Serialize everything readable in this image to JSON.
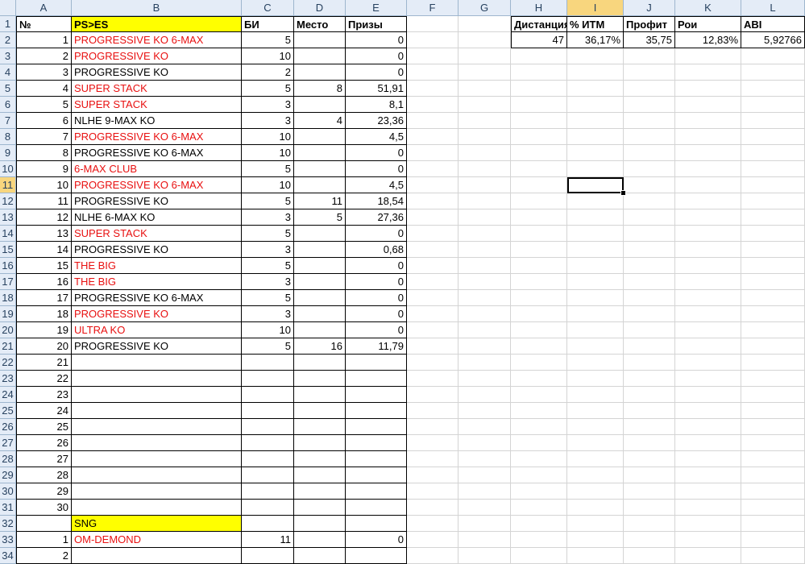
{
  "columns": [
    "A",
    "B",
    "C",
    "D",
    "E",
    "F",
    "G",
    "H",
    "I",
    "J",
    "K",
    "L"
  ],
  "selected_column": "I",
  "selected_row": 11,
  "row_numbers": [
    1,
    2,
    3,
    4,
    5,
    6,
    7,
    8,
    9,
    10,
    11,
    12,
    13,
    14,
    15,
    16,
    17,
    18,
    19,
    20,
    21,
    22,
    23,
    24,
    25,
    26,
    27,
    28,
    29,
    30,
    31,
    32,
    33,
    34
  ],
  "table_header": {
    "num": "№",
    "name": "PS>ES",
    "bi": "БИ",
    "place": "Место",
    "prize": "Призы"
  },
  "rows": [
    {
      "n": "1",
      "name": "PROGRESSIVE KO 6-MAX",
      "red": true,
      "bi": "5",
      "place": "",
      "prize": "0"
    },
    {
      "n": "2",
      "name": "PROGRESSIVE KO",
      "red": true,
      "bi": "10",
      "place": "",
      "prize": "0"
    },
    {
      "n": "3",
      "name": "PROGRESSIVE KO",
      "red": false,
      "bi": "2",
      "place": "",
      "prize": "0"
    },
    {
      "n": "4",
      "name": "SUPER STACK",
      "red": true,
      "bi": "5",
      "place": "8",
      "prize": "51,91"
    },
    {
      "n": "5",
      "name": "SUPER STACK",
      "red": true,
      "bi": "3",
      "place": "",
      "prize": "8,1"
    },
    {
      "n": "6",
      "name": "NLHE 9-MAX KO",
      "red": false,
      "bi": "3",
      "place": "4",
      "prize": "23,36"
    },
    {
      "n": "7",
      "name": "PROGRESSIVE KO 6-MAX",
      "red": true,
      "bi": "10",
      "place": "",
      "prize": "4,5"
    },
    {
      "n": "8",
      "name": "PROGRESSIVE KO 6-MAX",
      "red": false,
      "bi": "10",
      "place": "",
      "prize": "0"
    },
    {
      "n": "9",
      "name": "6-MAX CLUB",
      "red": true,
      "bi": "5",
      "place": "",
      "prize": "0"
    },
    {
      "n": "10",
      "name": "PROGRESSIVE KO 6-MAX",
      "red": true,
      "bi": "10",
      "place": "",
      "prize": "4,5"
    },
    {
      "n": "11",
      "name": "PROGRESSIVE KO",
      "red": false,
      "bi": "5",
      "place": "11",
      "prize": "18,54"
    },
    {
      "n": "12",
      "name": "NLHE 6-MAX KO",
      "red": false,
      "bi": "3",
      "place": "5",
      "prize": "27,36"
    },
    {
      "n": "13",
      "name": "SUPER STACK",
      "red": true,
      "bi": "5",
      "place": "",
      "prize": "0"
    },
    {
      "n": "14",
      "name": "PROGRESSIVE KO",
      "red": false,
      "bi": "3",
      "place": "",
      "prize": "0,68"
    },
    {
      "n": "15",
      "name": "THE BIG",
      "red": true,
      "bi": "5",
      "place": "",
      "prize": "0"
    },
    {
      "n": "16",
      "name": "THE BIG",
      "red": true,
      "bi": "3",
      "place": "",
      "prize": "0"
    },
    {
      "n": "17",
      "name": "PROGRESSIVE KO 6-MAX",
      "red": false,
      "bi": "5",
      "place": "",
      "prize": "0"
    },
    {
      "n": "18",
      "name": "PROGRESSIVE KO",
      "red": true,
      "bi": "3",
      "place": "",
      "prize": "0"
    },
    {
      "n": "19",
      "name": "ULTRA KO",
      "red": true,
      "bi": "10",
      "place": "",
      "prize": "0"
    },
    {
      "n": "20",
      "name": "PROGRESSIVE KO",
      "red": false,
      "bi": "5",
      "place": "16",
      "prize": "11,79"
    },
    {
      "n": "21",
      "name": "",
      "red": false,
      "bi": "",
      "place": "",
      "prize": ""
    },
    {
      "n": "22",
      "name": "",
      "red": false,
      "bi": "",
      "place": "",
      "prize": ""
    },
    {
      "n": "23",
      "name": "",
      "red": false,
      "bi": "",
      "place": "",
      "prize": ""
    },
    {
      "n": "24",
      "name": "",
      "red": false,
      "bi": "",
      "place": "",
      "prize": ""
    },
    {
      "n": "25",
      "name": "",
      "red": false,
      "bi": "",
      "place": "",
      "prize": ""
    },
    {
      "n": "26",
      "name": "",
      "red": false,
      "bi": "",
      "place": "",
      "prize": ""
    },
    {
      "n": "27",
      "name": "",
      "red": false,
      "bi": "",
      "place": "",
      "prize": ""
    },
    {
      "n": "28",
      "name": "",
      "red": false,
      "bi": "",
      "place": "",
      "prize": ""
    },
    {
      "n": "29",
      "name": "",
      "red": false,
      "bi": "",
      "place": "",
      "prize": ""
    },
    {
      "n": "30",
      "name": "",
      "red": false,
      "bi": "",
      "place": "",
      "prize": ""
    }
  ],
  "sng_header": "SNG",
  "sng_rows": [
    {
      "n": "1",
      "name": "OM-DEMOND",
      "red": true,
      "bi": "11",
      "place": "",
      "prize": "0"
    },
    {
      "n": "2",
      "name": "",
      "red": false,
      "bi": "",
      "place": "",
      "prize": ""
    }
  ],
  "stats": {
    "headers": [
      "Дистанция",
      "% ИТМ",
      "Профит",
      "Рои",
      "ABI"
    ],
    "values": [
      "47",
      "36,17%",
      "35,75",
      "12,83%",
      "5,92766"
    ]
  },
  "colors": {
    "header_bg": "#e4ecf7",
    "selected_header": "#f8d67e",
    "red_text": "#e81010",
    "yellow_fill": "#ffff00"
  }
}
